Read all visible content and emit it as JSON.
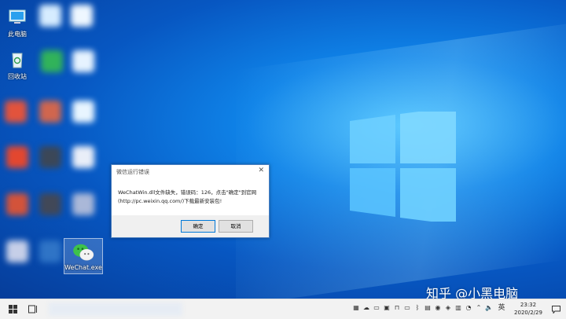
{
  "desktop": {
    "icons": [
      {
        "label": "此电脑",
        "icon": "computer-icon"
      },
      {
        "label": "回收站",
        "icon": "recycle-bin-icon"
      },
      {
        "label": "WeChat.exe",
        "icon": "wechat-icon"
      }
    ]
  },
  "dialog": {
    "title": "微信运行错误",
    "close_glyph": "✕",
    "message_line1": "WeChatWin.dll文件缺失，错误码：126，点击\"确定\"到官网",
    "message_line2": "(http://pc.weixin.qq.com/)下载最新安装包!",
    "ok_label": "确定",
    "cancel_label": "取消"
  },
  "taskbar": {
    "ime_label": "英",
    "time": "23:32",
    "date": "2020/2/29"
  },
  "watermark": {
    "text": "知乎 @小黑电脑"
  }
}
